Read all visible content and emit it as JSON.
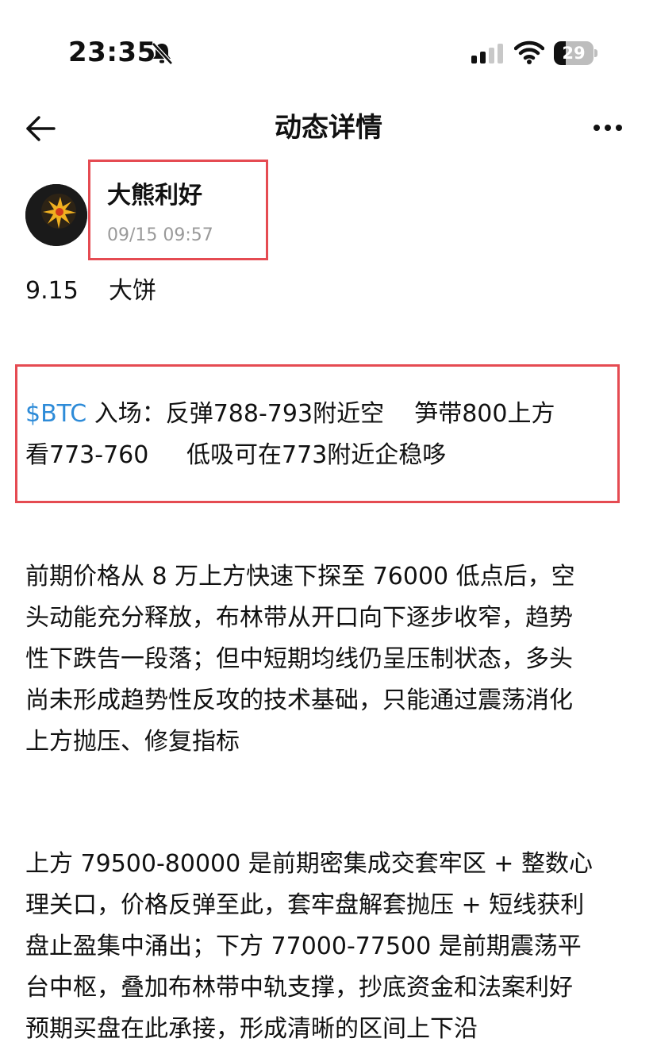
{
  "status_bar": {
    "time": "23:35",
    "battery_level": "29",
    "battery_fraction": 0.29
  },
  "nav": {
    "title": "动态详情"
  },
  "author": {
    "name": "大熊利好",
    "time": "09/15 09:57"
  },
  "post": {
    "subject": "9.15    大饼",
    "signal": {
      "ticker": "$BTC",
      "line1_rest": " 入场：反弹788-793附近空    笋带800上方",
      "line2": "看773-760     低吸可在773附近企稳哆"
    },
    "paragraph1": [
      "前期价格从 8 万上方快速下探至 76000 低点后，空",
      "头动能充分释放，布林带从开口向下逐步收窄，趋势",
      "性下跌告一段落；但中短期均线仍呈压制状态，多头",
      "尚未形成趋势性反攻的技术基础，只能通过震荡消化",
      "上方抛压、修复指标"
    ],
    "paragraph2": [
      "上方 79500-80000 是前期密集成交套牢区 + 整数心",
      "理关口，价格反弹至此，套牢盘解套抛压 + 短线获利",
      "盘止盈集中涌出；下方 77000-77500 是前期震荡平",
      "台中枢，叠加布林带中轨支撑，抄底资金和法案利好",
      "预期买盘在此承接，形成清晰的区间上下沿"
    ]
  },
  "colors": {
    "ticker": "#2d8bd8",
    "highlight_box": "#e54b52",
    "secondary_text": "#9a9a9a"
  },
  "icons": [
    "bell-slash-icon",
    "cellular-signal-icon",
    "wifi-icon",
    "battery-icon",
    "back-arrow-icon",
    "more-icon"
  ]
}
